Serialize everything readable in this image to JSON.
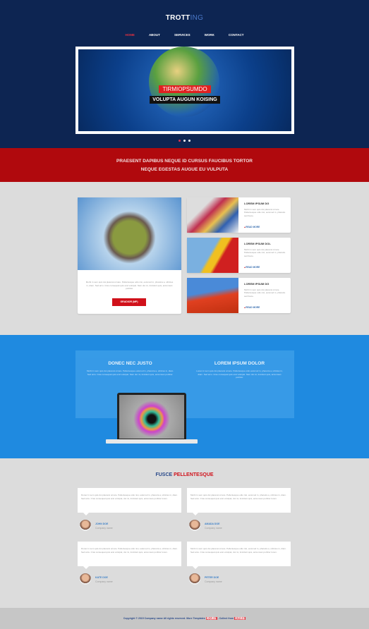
{
  "header": {
    "logo_main": "TROTT",
    "logo_accent": "ING",
    "nav": [
      "HOME",
      "ABOUT",
      "SERVICES",
      "WORK",
      "CONTACT"
    ],
    "active_nav": "HOME"
  },
  "slider": {
    "caption_top": "TIRMIOPSUMDO",
    "caption_bottom": "VOLUPTA AUGUN KOISING",
    "slides": 3,
    "active_slide": 1
  },
  "band": {
    "line1": "PRAESENT DAPIBUS NEQUE ID CURSUS FAUCIBUS TORTOR",
    "line2": "NEQUE EGESTAS AUGUE EU VULPUTA"
  },
  "features": {
    "main": {
      "text": "Morbi in sem quis dui placerat ornare. Pellentesque odio nisi, euismod in, pharetra a, ultricies in, diam. Sed arcu. Cras consequat quis erat volutpat. Nam dui mi, tincidunt quis, accumsan porttitor.",
      "button": "GRADIOR (MP)"
    },
    "items": [
      {
        "title": "LOREM IPSUM DG",
        "text": "Morbi in sem quis dui placerat ornare. Pellentesque odio nisi, euismod in, pharetra sed fusce.",
        "link": "READ MORE"
      },
      {
        "title": "LOREM IPSUM DOL",
        "text": "Morbi in sem quis dui placerat ornare. Pellentesque odio nisi, euismod in, pharetra sed fusce.",
        "link": "READ MORE"
      },
      {
        "title": "LOREM IPSUM DG",
        "text": "Morbi in sem quis dui placerat ornare. Pellentesque odio nisi, euismod in, pharetra sed fusce.",
        "link": "READ MORE"
      }
    ]
  },
  "blue": {
    "col1_title": "DONEC NEC JUSTO",
    "col1_text": "Morbi in sem quis dui placerat ornare. Pellentesque euismod in, pharetra a, ultricies in, diam. Sed arcu. Cras consequat quis erat volutpat. Nam dui mi, tincidunt quis, accumsan porttitor.",
    "col2_title": "LOREM IPSUM DOLOR",
    "col2_text": "Lorem in sem quis dui placerat ornare. Pellentesque odio euismod in, pharetra a, ultricies in, diam. Sed arcu. Cras consequat quis erat volutpat. Nam dui mi, tincidunt quis, accumsan porttitor."
  },
  "testimonials": {
    "title_main": "FUSCE",
    "title_accent": "PELLENTESQUE",
    "items": [
      {
        "text": "Donec in sem quis dui placerat ornare. Pellentesque odio nisi, euismod in, pharetra a, ultricies in, diam. Sed arcu. Cras consequat quis erat volutpat, dui mi, tincidunt quis, accumsan porttitor lorem.",
        "name": "JOHN DOE",
        "company": "Company name"
      },
      {
        "text": "Morbi in sem quis dui placerat ornare. Pellentesque odio nisi, euismod in, pharetra a, ultricies in, diam. Sed arcu. Cras consequat quis erat volutpat, dui mi, tincidunt quis, accumsan porttitor lorem.",
        "name": "AMADA DOE",
        "company": "Company name"
      },
      {
        "text": "Donec in sem quis dui placerat ornare. Pellentesque odio nisi, euismod in, pharetra a, ultricies in, diam. Sed arcu. Cras consequat quis erat volutpat, dui mi, tincidunt quis, accumsan porttitor lorem.",
        "name": "KATE DOE",
        "company": "Company name"
      },
      {
        "text": "Morbi in sem quis dui placerat ornare. Pellentesque odio nisi, euismod in, pharetra a, ultricies in, diam. Sed arcu. Cras consequat quis erat volutpat, dui mi, tincidunt quis, accumsan porttitor lorem.",
        "name": "PETER DOE",
        "company": "Company name"
      }
    ]
  },
  "footer": {
    "text": "Copyright © 2015 Company name All rights reserved. More Templates",
    "link1": "网站模板",
    "sep": " - Collect from ",
    "link2": "网页模板"
  },
  "colors": {
    "navy": "#0d2552",
    "red": "#b0090d",
    "blue": "#1f8ae0",
    "gray": "#dcdcdc"
  }
}
